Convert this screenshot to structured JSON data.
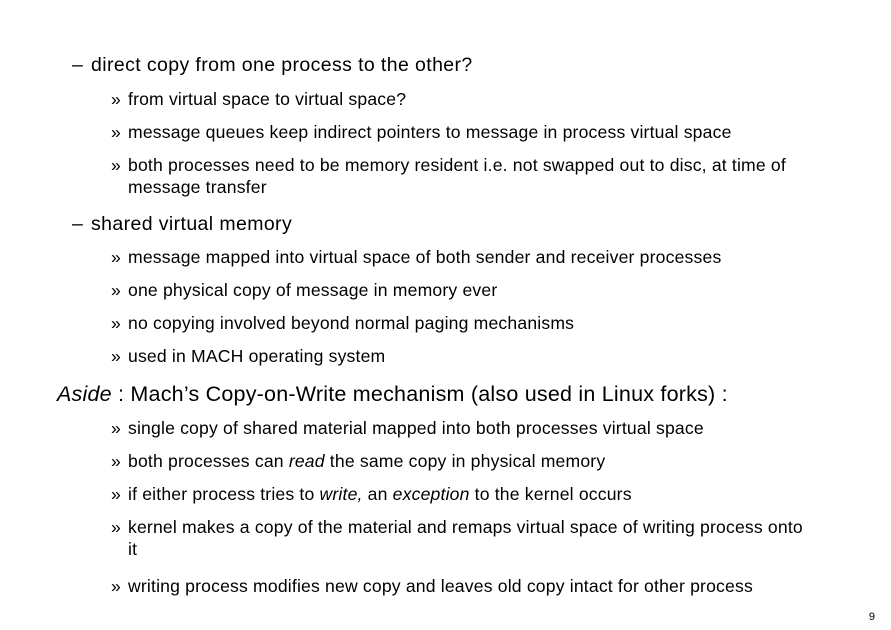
{
  "slide": {
    "page_number": "9",
    "bullet_marker_level1": "–",
    "bullet_marker_level2": "»",
    "content": [
      {
        "level": 1,
        "text": "direct copy from one process to the other?"
      },
      {
        "level": 2,
        "text": "from virtual space to virtual space?"
      },
      {
        "level": 2,
        "text": "message queues keep indirect pointers to message in process virtual space"
      },
      {
        "level": 2,
        "text": "both processes need to be memory resident i.e. not swapped out to disc, at time of message transfer"
      },
      {
        "level": 1,
        "text": "shared virtual memory"
      },
      {
        "level": 2,
        "text": "message mapped into virtual space of both sender and receiver processes"
      },
      {
        "level": 2,
        "text": "one physical copy of message in memory ever"
      },
      {
        "level": 2,
        "text": "no copying involved beyond normal paging mechanisms"
      },
      {
        "level": 2,
        "text": "used in MACH operating system"
      }
    ],
    "aside": {
      "emphasis": "Aside",
      "rest": " : Mach’s Copy-on-Write mechanism (also used in Linux forks) :"
    },
    "aside_content": [
      {
        "level": 2,
        "text": "single copy of shared material mapped into both processes virtual space"
      },
      {
        "level": 2,
        "segments": [
          {
            "text": "both processes can ",
            "italic": false
          },
          {
            "text": "read",
            "italic": true
          },
          {
            "text": " the same copy in physical memory",
            "italic": false
          }
        ]
      },
      {
        "level": 2,
        "segments": [
          {
            "text": "if either process tries to ",
            "italic": false
          },
          {
            "text": "write,",
            "italic": true
          },
          {
            "text": " an ",
            "italic": false
          },
          {
            "text": "exception",
            "italic": true
          },
          {
            "text": " to the kernel occurs",
            "italic": false
          }
        ]
      },
      {
        "level": 2,
        "text": "kernel makes a copy of the material and remaps virtual space of writing process onto it"
      },
      {
        "level": 2,
        "text": "writing process modifies new copy and leaves old copy intact for other process"
      }
    ]
  }
}
